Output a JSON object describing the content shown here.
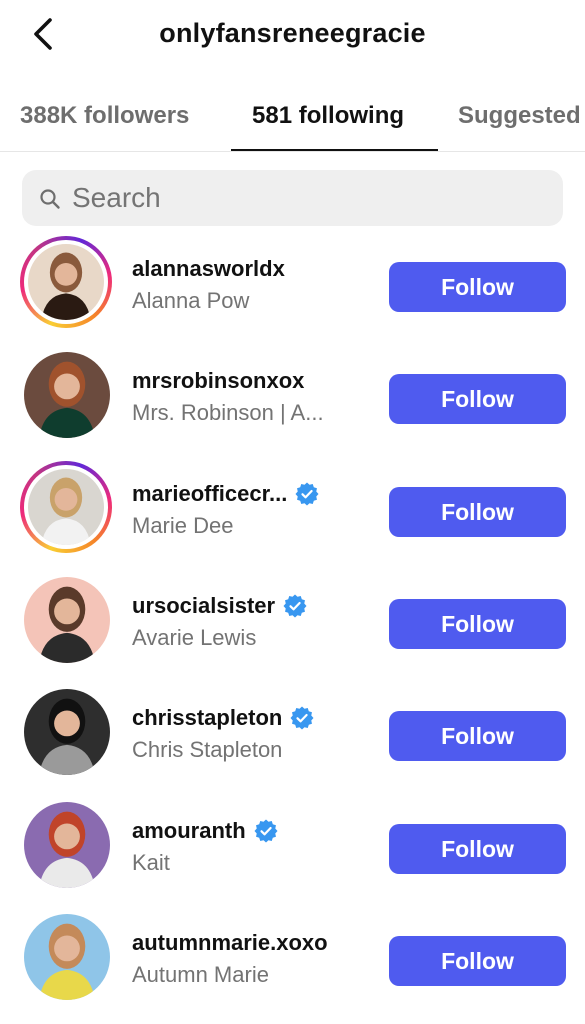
{
  "header": {
    "title": "onlyfansreneegracie",
    "back_icon": "chevron-left-icon"
  },
  "tabs": [
    {
      "label": "388K followers",
      "active": false
    },
    {
      "label": "581 following",
      "active": true
    },
    {
      "label": "Suggested",
      "active": false
    }
  ],
  "search": {
    "placeholder": "Search",
    "value": "",
    "icon": "search-icon"
  },
  "accent_color": "#4f5bef",
  "verified_color": "#3897f0",
  "users": [
    {
      "username": "alannasworldx",
      "full_name": "Alanna Pow",
      "verified": false,
      "has_story": true,
      "button": "Follow",
      "avatar_icon": "profile-photo"
    },
    {
      "username": "mrsrobinsonxox",
      "full_name": "Mrs. Robinson | A...",
      "verified": false,
      "has_story": false,
      "button": "Follow",
      "avatar_icon": "profile-photo"
    },
    {
      "username": "marieofficecr...",
      "full_name": "Marie Dee",
      "verified": true,
      "has_story": true,
      "button": "Follow",
      "avatar_icon": "profile-photo"
    },
    {
      "username": "ursocialsister",
      "full_name": "Avarie Lewis",
      "verified": true,
      "has_story": false,
      "button": "Follow",
      "avatar_icon": "profile-photo"
    },
    {
      "username": "chrisstapleton",
      "full_name": "Chris Stapleton",
      "verified": true,
      "has_story": false,
      "button": "Follow",
      "avatar_icon": "profile-photo"
    },
    {
      "username": "amouranth",
      "full_name": "Kait",
      "verified": true,
      "has_story": false,
      "button": "Follow",
      "avatar_icon": "profile-photo"
    },
    {
      "username": "autumnmarie.xoxo",
      "full_name": "Autumn Marie",
      "verified": false,
      "has_story": false,
      "button": "Follow",
      "avatar_icon": "profile-photo"
    }
  ]
}
